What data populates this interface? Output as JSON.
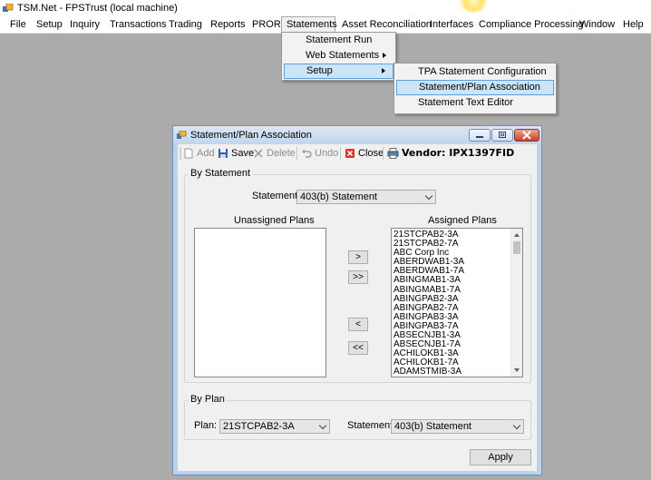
{
  "app": {
    "title": "TSM.Net - FPSTrust (local machine)"
  },
  "menubar": {
    "items": [
      "File",
      "Setup",
      "Inquiry",
      "Transactions",
      "Trading",
      "Reports",
      "PROR",
      "Statements",
      "Asset Reconciliation",
      "Interfaces",
      "Compliance Processing",
      "Window",
      "Help"
    ],
    "open_item": "Statements"
  },
  "statements_menu": {
    "items": [
      "Statement Run",
      "Web Statements",
      "Setup"
    ],
    "highlighted": "Setup"
  },
  "setup_submenu": {
    "items": [
      "TPA Statement Configuration",
      "Statement/Plan Association",
      "Statement Text Editor"
    ],
    "highlighted": "Statement/Plan Association"
  },
  "dialog": {
    "title": "Statement/Plan Association",
    "toolbar": {
      "add": "Add",
      "save": "Save",
      "delete": "Delete",
      "undo": "Undo",
      "close": "Close",
      "vendor": "Vendor: IPX1397FID"
    },
    "by_statement": {
      "legend": "By Statement",
      "statement_label": "Statement:",
      "statement_value": "403(b) Statement",
      "unassigned_header": "Unassigned Plans",
      "assigned_header": "Assigned Plans",
      "unassigned_plans": [],
      "assigned_plans": [
        "21STCPAB2-3A",
        "21STCPAB2-7A",
        "ABC Corp Inc",
        "ABERDWAB1-3A",
        "ABERDWAB1-7A",
        "ABINGMAB1-3A",
        "ABINGMAB1-7A",
        "ABINGPAB2-3A",
        "ABINGPAB2-7A",
        "ABINGPAB3-3A",
        "ABINGPAB3-7A",
        "ABSECNJB1-3A",
        "ABSECNJB1-7A",
        "ACHILOKB1-3A",
        "ACHILOKB1-7A",
        "ADAMSTMIB-3A"
      ],
      "buttons": {
        "assign_one": ">",
        "assign_all": ">>",
        "remove_one": "<",
        "remove_all": "<<"
      }
    },
    "by_plan": {
      "legend": "By Plan",
      "plan_label": "Plan:",
      "plan_value": "21STCPAB2-3A",
      "statement_label": "Statement:",
      "statement_value": "403(b) Statement"
    },
    "apply_label": "Apply"
  },
  "colors": {
    "desktop": "#ababab",
    "menu_highlight": "#cce4f7",
    "dialog_frame": "#bcd1ea",
    "close_button": "#c4412b"
  }
}
